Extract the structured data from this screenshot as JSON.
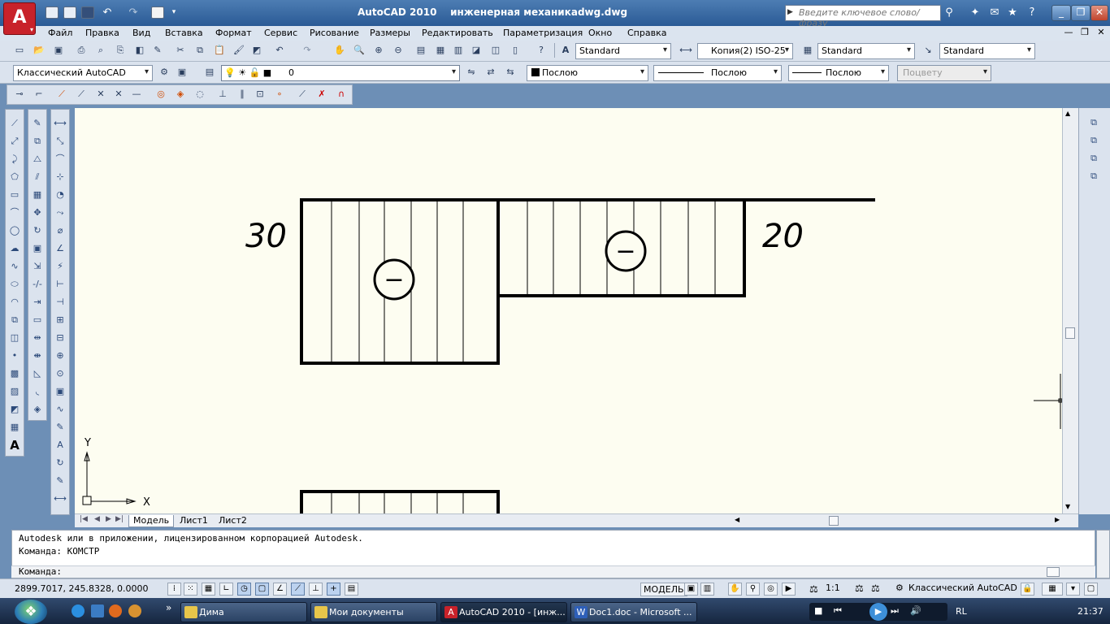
{
  "app": {
    "logo_letter": "A",
    "logo_menu_arrow": "▾",
    "title": "AutoCAD 2010    инженерная механикadwg.dwg",
    "search_placeholder": "Введите ключевое слово/фразу",
    "window_buttons": [
      "_",
      "❐",
      "✕"
    ]
  },
  "menubar": {
    "items": [
      "Файл",
      "Правка",
      "Вид",
      "Вставка",
      "Формат",
      "Сервис",
      "Рисование",
      "Размеры",
      "Редактировать",
      "Параметризация",
      "Окно",
      "Справка"
    ],
    "mdi_buttons": [
      "—",
      "❐",
      "✕"
    ]
  },
  "toolbar_standard": {
    "text_style": "Standard",
    "dim_style": "Копия(2) ISO-25",
    "table_style": "Standard",
    "multileader_style": "Standard"
  },
  "toolbar_layers": {
    "workspace": "Классический AutoCAD",
    "layer": "0",
    "color": "Послою",
    "linetype": "Послою",
    "lineweight": "Послою",
    "plotstyle": "Поцвету"
  },
  "drawing": {
    "dim_left": "30",
    "dim_right": "20",
    "ucs_x": "X",
    "ucs_y": "Y",
    "left_sign": "−",
    "right_sign": "−"
  },
  "tabs": [
    "Модель",
    "Лист1",
    "Лист2"
  ],
  "command": {
    "lines": [
      "Autodesk или в приложении, лицензированном корпорацией Autodesk.",
      "Команда: КОМСТР"
    ],
    "prompt": "Команда:"
  },
  "status": {
    "coords": "2899.7017, 245.8328, 0.0000",
    "model": "МОДЕЛЬ",
    "scale": "1:1",
    "workspace": "Классический AutoCAD"
  },
  "taskbar": {
    "tasks": [
      "Дима",
      "Мои документы",
      "AutoCAD 2010 - [инж...",
      "Doc1.doc - Microsoft ..."
    ],
    "lang": "RL",
    "clock": "21:37"
  },
  "icons": [
    "autocad-logo-icon",
    "new-icon",
    "open-icon",
    "save-icon",
    "undo-icon",
    "redo-icon",
    "plot-icon",
    "search-icon",
    "help-icon",
    "line-icon",
    "circle-icon",
    "arc-icon",
    "erase-icon",
    "move-icon",
    "text-icon",
    "osnap-icon",
    "ucs-icon",
    "windows-start-icon"
  ],
  "colors": {
    "titlebar": "#2a5a95",
    "canvas_bg": "#fdfdf1",
    "logo_red": "#c8222a",
    "toolbar_bg": "#dbe3ee"
  }
}
